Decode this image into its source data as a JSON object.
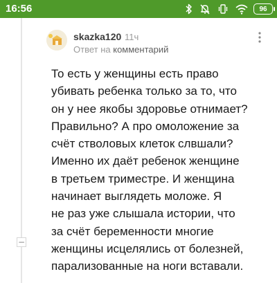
{
  "status_bar": {
    "time": "16:56",
    "battery": "96",
    "icons": [
      "bluetooth-icon",
      "alarm-off-icon",
      "vibrate-icon",
      "wifi-icon",
      "battery-icon"
    ]
  },
  "comment": {
    "author": "skazka120",
    "time": "11ч",
    "reply_prefix": "Ответ на",
    "reply_target": "комментарий",
    "body_lines": [
      "То есть у женщины есть право",
      "убивать ребенка только за то, что",
      "он у нее якобы здоровье отнимает?",
      "Правильно? А про омоложение за",
      "счёт стволовых клеток слвшали?",
      "Именно их даёт ребенок женщине",
      "в третьем триместре. И женщина",
      "начинает выглядеть моложе. Я",
      "не раз уже слышала истории, что",
      "за счёт беременности многие",
      "женщины исцелялись от болезней,",
      "парализованные на ноги вставали."
    ]
  },
  "thread": {
    "collapse_label": "−"
  },
  "colors": {
    "status_bar": "#4f9a2a",
    "text": "#1a1a1a",
    "muted": "#9a9a9a"
  }
}
